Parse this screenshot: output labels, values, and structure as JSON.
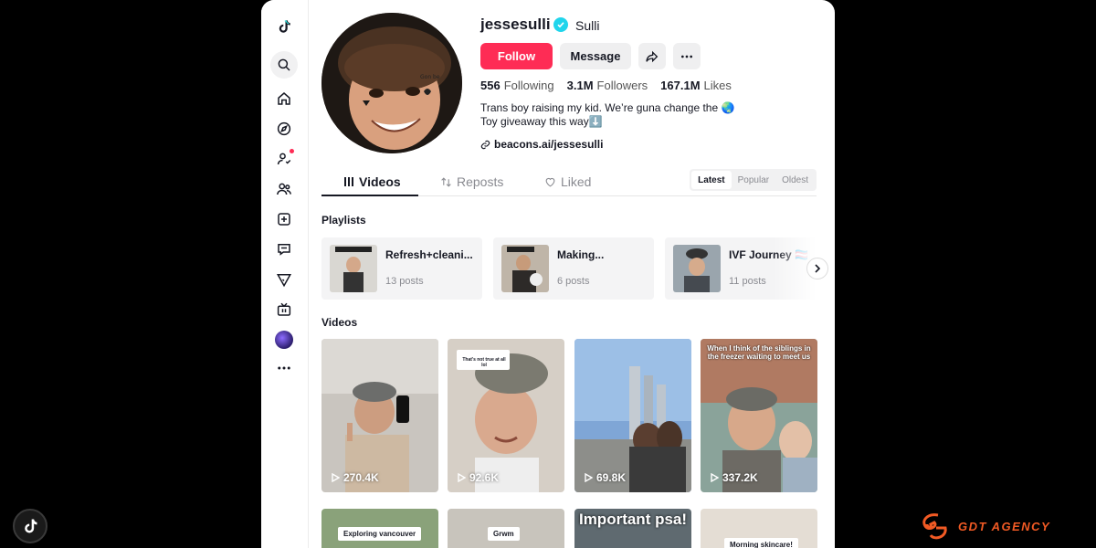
{
  "profile": {
    "username": "jessesulli",
    "nickname": "Sulli",
    "follow_label": "Follow",
    "message_label": "Message",
    "stats": [
      {
        "value": "556",
        "label": "Following"
      },
      {
        "value": "3.1M",
        "label": "Followers"
      },
      {
        "value": "167.1M",
        "label": "Likes"
      }
    ],
    "bio_line1": "Trans boy raising my kid. We’re guna change the 🌏",
    "bio_line2": "Toy giveaway this way⬇️",
    "link": "beacons.ai/jessesulli"
  },
  "tabs": [
    {
      "label": "Videos",
      "icon": "grid-icon"
    },
    {
      "label": "Reposts",
      "icon": "repost-icon"
    },
    {
      "label": "Liked",
      "icon": "heart-icon"
    }
  ],
  "sort": [
    "Latest",
    "Popular",
    "Oldest"
  ],
  "playlists_title": "Playlists",
  "playlists": [
    {
      "name": "Refresh+cleani...",
      "count": "13 posts"
    },
    {
      "name": "Making...",
      "count": "6 posts"
    },
    {
      "name": "IVF Journey 🏳️‍⚧️",
      "count": "11 posts"
    }
  ],
  "videos_title": "Videos",
  "videos": [
    {
      "views": "270.4K",
      "caption": ""
    },
    {
      "views": "92.6K",
      "caption": "That's not true at all lol"
    },
    {
      "views": "69.8K",
      "caption": ""
    },
    {
      "views": "337.2K",
      "caption": "When I think of the siblings in the freezer waiting to meet us"
    }
  ],
  "videos_row2": [
    {
      "caption": "Exploring vancouver"
    },
    {
      "caption": "Grwm"
    },
    {
      "caption": "Important psa!"
    },
    {
      "caption": "Morning skincare!"
    }
  ],
  "watermark": {
    "brand": "GDT AGENCY"
  },
  "colors": {
    "accent": "#fe2c55",
    "verified": "#20d5ec",
    "brand": "#f15a24"
  }
}
